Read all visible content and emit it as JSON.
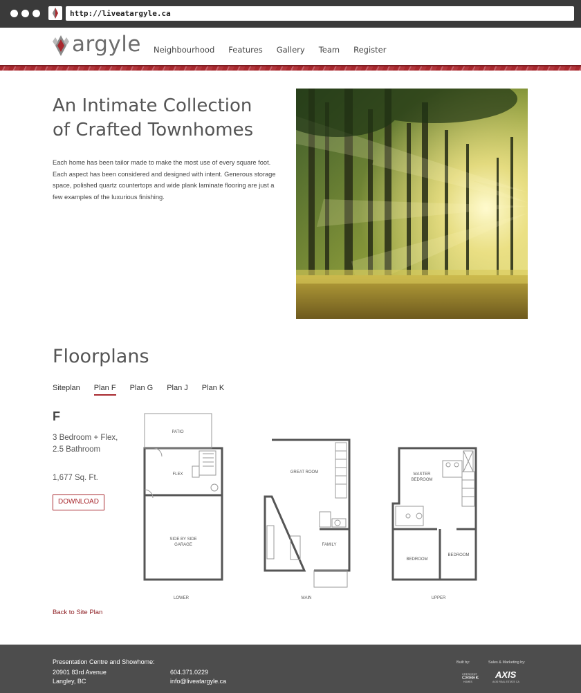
{
  "browser": {
    "url": "http://liveatargyle.ca"
  },
  "header": {
    "logo_text": "argyle",
    "nav": [
      "Neighbourhood",
      "Features",
      "Gallery",
      "Team",
      "Register"
    ],
    "accent": "#a8282e"
  },
  "intro": {
    "title_line1": "An Intimate Collection",
    "title_line2": "of Crafted Townhomes",
    "body": "Each home has been tailor made to make the most use of every square foot. Each aspect has been considered and designed with intent. Generous storage space, polished quartz countertops and wide plank laminate flooring are just a few examples of the luxurious finishing."
  },
  "floorplans": {
    "title": "Floorplans",
    "tabs": [
      "Siteplan",
      "Plan F",
      "Plan G",
      "Plan J",
      "Plan K"
    ],
    "active_tab": "Plan F",
    "plan_letter": "F",
    "bedrooms": "3 Bedroom + Flex,",
    "bathrooms": "2.5 Bathroom",
    "sqft": "1,677 Sq. Ft.",
    "download_label": "DOWNLOAD",
    "levels": [
      "LOWER",
      "MAIN",
      "UPPER"
    ],
    "rooms": {
      "patio": "PATIO",
      "flex": "FLEX",
      "garage_line1": "SIDE BY SIDE",
      "garage_line2": "GARAGE",
      "great_room": "GREAT ROOM",
      "family": "FAMILY",
      "master_line1": "MASTER",
      "master_line2": "BEDROOM",
      "bedroom_left": "BEDROOM",
      "bedroom_right": "BEDROOM"
    },
    "back_link": "Back to Site Plan"
  },
  "footer": {
    "label": "Presentation Centre and Showhome:",
    "address_line1": "20901 83rd Avenue",
    "address_line2": "Langley, BC",
    "phone": "604.371.0229",
    "email": "info@liveatargyle.ca",
    "built_by": "Built by:",
    "marketing_by": "Sales & Marketing by:",
    "builder_logo": "CRESCENT CREEK HOMES",
    "marketing_logo": "AXIS",
    "marketing_logo_sub": "AXIS REAL ESTATE CA"
  }
}
